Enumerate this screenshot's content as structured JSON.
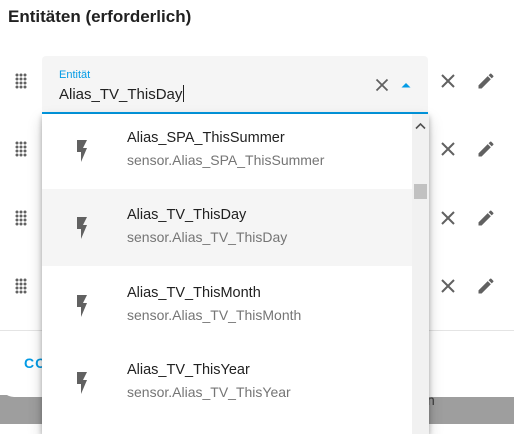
{
  "section": {
    "title": "Entitäten (erforderlich)"
  },
  "entity_field": {
    "label": "Entität",
    "value": "Alias_TV_ThisDay"
  },
  "options": [
    {
      "name": "Alias_SPA_ThisSummer",
      "id": "sensor.Alias_SPA_ThisSummer",
      "icon": "flash-icon"
    },
    {
      "name": "Alias_TV_ThisDay",
      "id": "sensor.Alias_TV_ThisDay",
      "icon": "flash-icon",
      "selected": true
    },
    {
      "name": "Alias_TV_ThisMonth",
      "id": "sensor.Alias_TV_ThisMonth",
      "icon": "flash-icon"
    },
    {
      "name": "Alias_TV_ThisYear",
      "id": "sensor.Alias_TV_ThisYear",
      "icon": "flash-icon"
    }
  ],
  "footer": {
    "left_text": "CO",
    "right_text": "n"
  },
  "colors": {
    "accent": "#039be5",
    "icon": "#616161"
  }
}
